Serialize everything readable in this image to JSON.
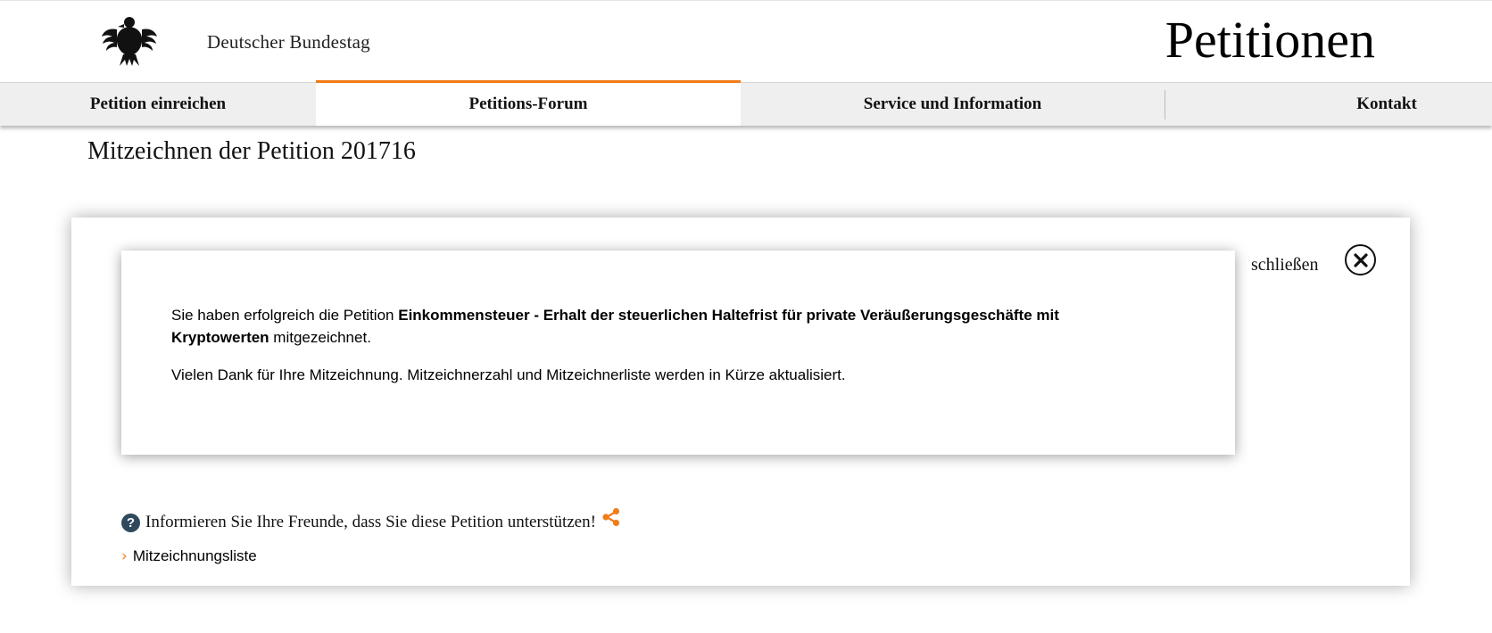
{
  "header": {
    "brand": "Deutscher Bundestag",
    "site_title": "Petitionen",
    "logo_icon": "bundesadler-eagle-icon"
  },
  "nav": {
    "items": [
      {
        "label": "Petition einreichen",
        "active": false
      },
      {
        "label": "Petitions-Forum",
        "active": true
      },
      {
        "label": "Service und Information",
        "active": false
      },
      {
        "label": "Kontakt",
        "active": false
      }
    ]
  },
  "page": {
    "title": "Mitzeichnen der Petition 201716"
  },
  "dialog": {
    "close_label": "schließen",
    "close_icon": "close-icon",
    "message": {
      "line1_prefix": "Sie haben erfolgreich die Petition ",
      "petition_title": "Einkommensteuer - Erhalt der steuerlichen Haltefrist für private Veräußerungsgeschäfte mit Kryptowerten",
      "line1_suffix": " mitgezeichnet.",
      "line2": "Vielen Dank für Ihre Mitzeichnung. Mitzeichnerzahl und Mitzeichnerliste werden in Kürze aktualisiert."
    }
  },
  "share": {
    "help_icon_glyph": "?",
    "text": "Informieren Sie Ihre Freunde, dass Sie diese Petition unterstützen!",
    "icon": "share-icon"
  },
  "links": {
    "signature_list": "Mitzeichnungsliste",
    "chevron": "›"
  },
  "colors": {
    "accent": "#f07d1a",
    "nav_bg": "#efefef",
    "help_icon_bg": "#2f4a5c"
  }
}
